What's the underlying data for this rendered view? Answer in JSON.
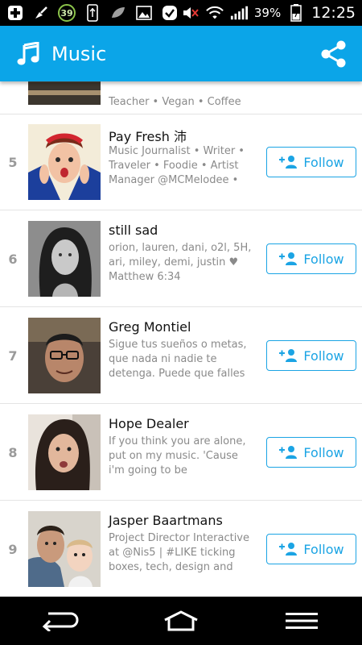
{
  "status_bar": {
    "notification_badge": "39",
    "battery_percent": "39%",
    "time": "12:25",
    "icons": [
      "add-icon",
      "cleanup-icon",
      "usb-icon",
      "leaf-icon",
      "gallery-icon",
      "check-icon",
      "mute-icon",
      "wifi-icon",
      "signal-icon",
      "battery-icon"
    ]
  },
  "app_bar": {
    "title": "Music",
    "brand_color": "#0ba5e8",
    "icons": [
      "music-note-icon",
      "share-icon"
    ]
  },
  "list": {
    "partial_top": {
      "bio": "Teacher • Vegan • Coffee"
    },
    "follow_color": "#1ba4e4",
    "users": [
      {
        "rank": "5",
        "name": "Pay Fresh 沛",
        "bio": "Music Journalist • Writer • Traveler • Foodie • Artist Manager @MCMelodee •",
        "follow_label": "Follow"
      },
      {
        "rank": "6",
        "name": "still sad",
        "bio": "orion, lauren, dani, o2l, 5H, ari, miley, demi, justin ♥ Matthew 6:34",
        "follow_label": "Follow"
      },
      {
        "rank": "7",
        "name": "Greg Montiel",
        "bio": "Sigue tus sueños o metas, que nada ni nadie te detenga. Puede que falles",
        "follow_label": "Follow"
      },
      {
        "rank": "8",
        "name": "Hope Dealer",
        "bio": "If you think you are alone, put on my music. 'Cause i'm going to be",
        "follow_label": "Follow"
      },
      {
        "rank": "9",
        "name": "Jasper Baartmans",
        "bio": "Project Director Interactive at @Nis5 | #LIKE ticking boxes, tech, design and",
        "follow_label": "Follow"
      }
    ]
  },
  "nav_bar": {
    "icons": [
      "back-icon",
      "home-icon",
      "menu-icon"
    ]
  }
}
